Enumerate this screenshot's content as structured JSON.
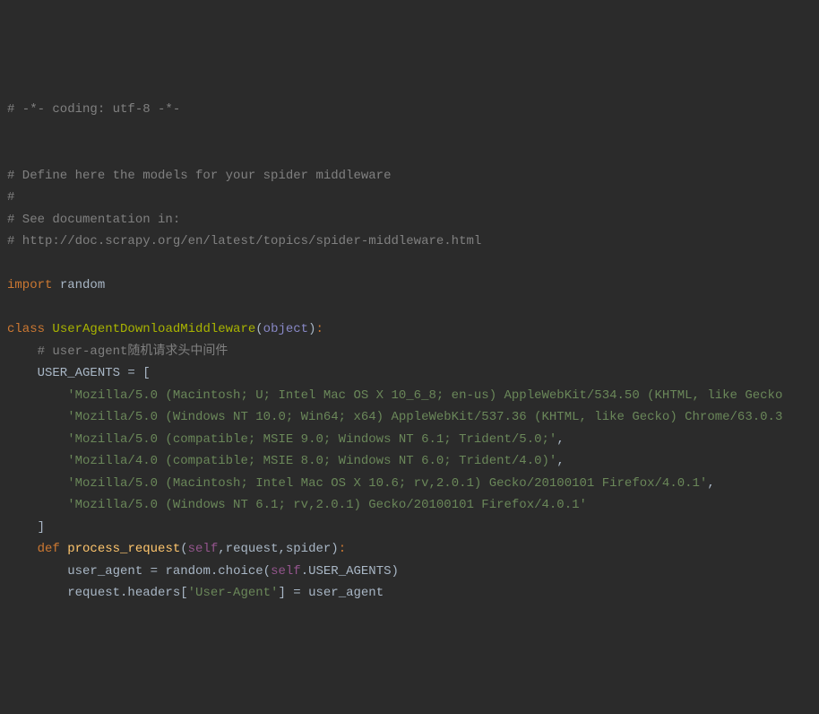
{
  "code": {
    "c1": "# -*- coding: utf-8 -*-",
    "c2": "# Define here the models for your spider middleware",
    "c3": "#",
    "c4": "# See documentation in:",
    "c5": "# http://doc.scrapy.org/en/latest/topics/spider-middleware.html",
    "kw_import": "import",
    "mod_random": " random",
    "kw_class": "class",
    "classname": " UserAgentDownloadMiddleware",
    "paren_open": "(",
    "obj": "object",
    "paren_close": ")",
    "colon": ":",
    "c_ua": "    # user-agent随机请求头中间件",
    "ua_ident": "    USER_AGENTS ",
    "eq": "= ",
    "bracket_open": "[",
    "s1": "        'Mozilla/5.0 (Macintosh; U; Intel Mac OS X 10_6_8; en-us) AppleWebKit/534.50 (KHTML, like Gecko",
    "s2": "        'Mozilla/5.0 (Windows NT 10.0; Win64; x64) AppleWebKit/537.36 (KHTML, like Gecko) Chrome/63.0.3",
    "s3_pre": "        ",
    "s3": "'Mozilla/5.0 (compatible; MSIE 9.0; Windows NT 6.1; Trident/5.0;'",
    "comma": ",",
    "s4_pre": "        ",
    "s4": "'Mozilla/4.0 (compatible; MSIE 8.0; Windows NT 6.0; Trident/4.0)'",
    "s5_pre": "        ",
    "s5": "'Mozilla/5.0 (Macintosh; Intel Mac OS X 10.6; rv,2.0.1) Gecko/20100101 Firefox/4.0.1'",
    "s6_pre": "        ",
    "s6": "'Mozilla/5.0 (Windows NT 6.1; rv,2.0.1) Gecko/20100101 Firefox/4.0.1'",
    "bracket_close": "    ]",
    "indent_def": "    ",
    "kw_def": "def",
    "funcname": " process_request",
    "p_open": "(",
    "p_self": "self",
    "p_rest": ",request,spider",
    "p_close": ")",
    "body1_a": "        user_agent ",
    "body1_eq": "= ",
    "body1_b": "random.choice(",
    "body1_self": "self",
    "body1_c": ".USER_AGENTS)",
    "body2_a": "        request.headers[",
    "body2_key": "'User-Agent'",
    "body2_b": "] ",
    "body2_eq": "= ",
    "body2_c": "user_agent"
  }
}
